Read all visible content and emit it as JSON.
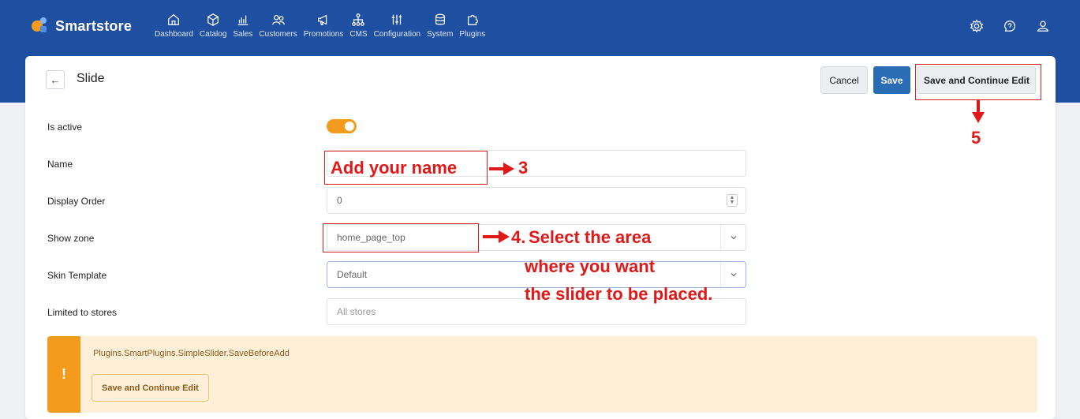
{
  "brand": {
    "name": "Smartstore"
  },
  "nav": [
    {
      "label": "Dashboard",
      "icon": "home-icon"
    },
    {
      "label": "Catalog",
      "icon": "box-icon"
    },
    {
      "label": "Sales",
      "icon": "chart-icon"
    },
    {
      "label": "Customers",
      "icon": "users-icon"
    },
    {
      "label": "Promotions",
      "icon": "megaphone-icon"
    },
    {
      "label": "CMS",
      "icon": "sitemap-icon"
    },
    {
      "label": "Configuration",
      "icon": "sliders-icon"
    },
    {
      "label": "System",
      "icon": "database-icon"
    },
    {
      "label": "Plugins",
      "icon": "puzzle-icon"
    }
  ],
  "page": {
    "title": "Slide"
  },
  "actions": {
    "cancel": "Cancel",
    "save": "Save",
    "save_continue": "Save and Continue Edit"
  },
  "form": {
    "is_active_label": "Is active",
    "is_active": true,
    "name_label": "Name",
    "name_value": "",
    "display_order_label": "Display Order",
    "display_order_value": "0",
    "show_zone_label": "Show zone",
    "show_zone_value": "home_page_top",
    "skin_template_label": "Skin Template",
    "skin_template_value": "Default",
    "limited_stores_label": "Limited to stores",
    "limited_stores_placeholder": "All stores"
  },
  "alert": {
    "icon": "!",
    "text": "Plugins.SmartPlugins.SimpleSlider.SaveBeforeAdd",
    "button": "Save and Continue Edit"
  },
  "annotations": {
    "name_note": "Add your name",
    "name_step": "3",
    "zone_step": "4.",
    "zone_line1": "Select the area",
    "zone_line2": "where you want",
    "zone_line3": "the slider to be placed.",
    "save_step": "5"
  },
  "colors": {
    "nav_bg": "#1f4fa0",
    "accent": "#f29b1d",
    "primary": "#2a6db5",
    "annotation": "#e01818"
  }
}
